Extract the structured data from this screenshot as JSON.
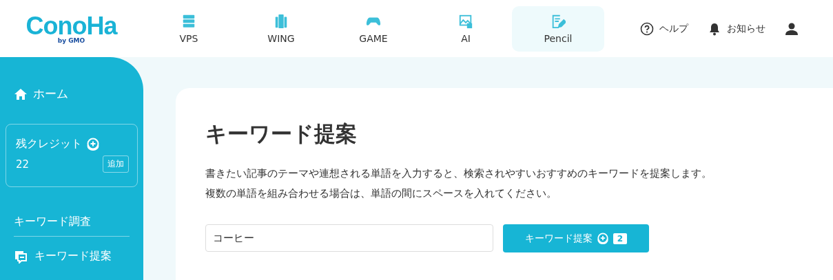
{
  "logo": {
    "name": "ConoHa",
    "sub": "by GMO"
  },
  "nav": [
    {
      "label": "VPS",
      "kind": "server",
      "selected": false
    },
    {
      "label": "WING",
      "kind": "devices",
      "selected": false
    },
    {
      "label": "GAME",
      "kind": "gamepad",
      "selected": false
    },
    {
      "label": "AI",
      "kind": "image",
      "selected": false
    },
    {
      "label": "Pencil",
      "kind": "pencil",
      "selected": true
    }
  ],
  "header_links": [
    {
      "label": "ヘルプ",
      "kind": "help"
    },
    {
      "label": "お知らせ",
      "kind": "bell"
    }
  ],
  "sidebar": {
    "home": "ホーム",
    "credit": {
      "label": "残クレジット",
      "value": "22",
      "add": "追加"
    },
    "section": "キーワード調査",
    "items": [
      {
        "label": "キーワード提案"
      }
    ]
  },
  "main": {
    "title": "キーワード提案",
    "description": [
      "書きたい記事のテーマや連想される単語を入力すると、検索されやすいおすすめのキーワードを提案します。",
      "複数の単語を組み合わせる場合は、単語の間にスペースを入れてください。"
    ],
    "input": {
      "value": "コーヒー"
    },
    "button": {
      "label": "キーワード提案",
      "cost": "2"
    }
  }
}
